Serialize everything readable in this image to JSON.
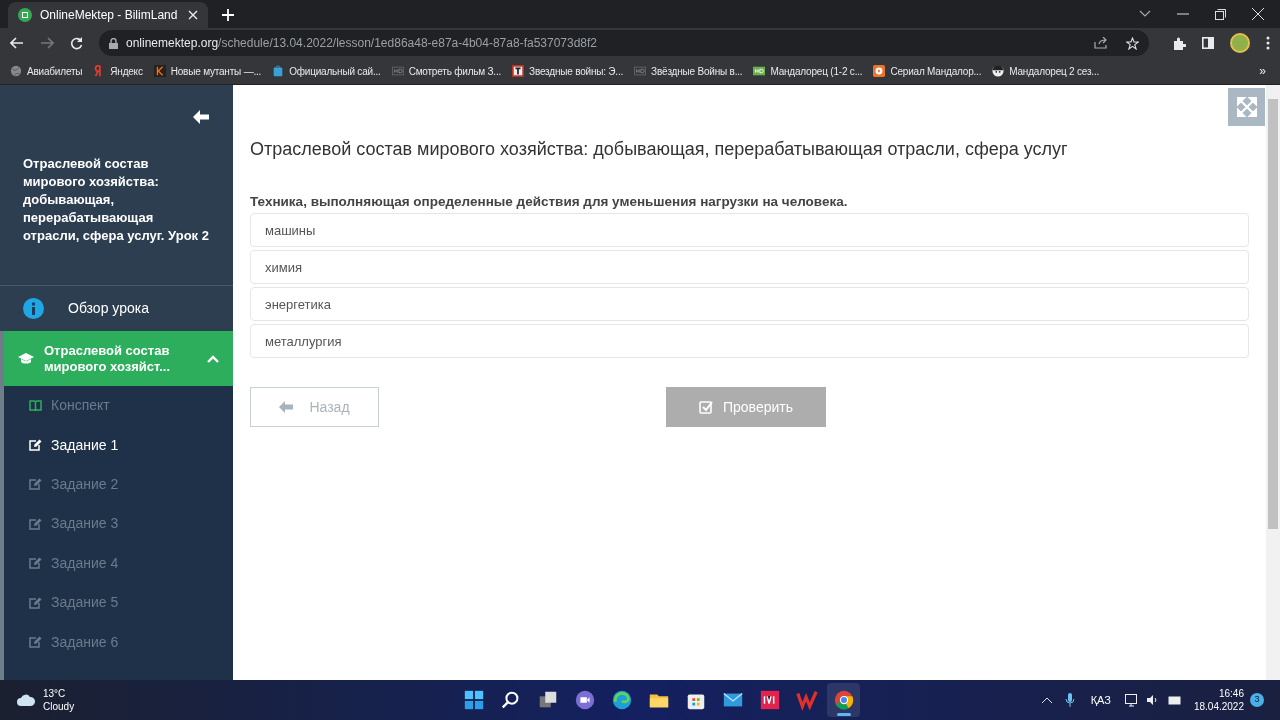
{
  "browser": {
    "tab": {
      "title": "OnlineMektep - BilimLand"
    },
    "url_host": "onlinemektep.org",
    "url_path": "/schedule/13.04.2022/lesson/1ed86a48-e87a-4b04-87a8-fa537073d8f2",
    "bookmarks": [
      {
        "label": "Авиабилеты",
        "kind": "globe"
      },
      {
        "label": "Яндекс",
        "kind": "yandex"
      },
      {
        "label": "Новые мутанты —...",
        "kind": "k"
      },
      {
        "label": "Официальный сай...",
        "kind": "bag"
      },
      {
        "label": "Смотреть фильм З...",
        "kind": "hd"
      },
      {
        "label": "Звездные войны: Э...",
        "kind": "t"
      },
      {
        "label": "Звёздные Войны в...",
        "kind": "hd"
      },
      {
        "label": "Мандалорец (1-2 с...",
        "kind": "hdgreen"
      },
      {
        "label": "Сериал Мандалор...",
        "kind": "play"
      },
      {
        "label": "Мандалорец 2 сез...",
        "kind": "face"
      }
    ],
    "bookmarks_more": "»"
  },
  "sidebar": {
    "title": "Отраслевой состав мирового хозяйства: добывающая, перерабатывающая отрасли, сфера услуг. Урок 2",
    "overview": "Обзор урока",
    "section": {
      "label": "Отраслевой состав мирового хозяйст...",
      "expanded": true,
      "items": [
        {
          "label": "Конспект",
          "kind": "notes",
          "selected": false
        },
        {
          "label": "Задание 1",
          "kind": "task",
          "selected": true
        },
        {
          "label": "Задание 2",
          "kind": "task",
          "selected": false
        },
        {
          "label": "Задание 3",
          "kind": "task",
          "selected": false
        },
        {
          "label": "Задание 4",
          "kind": "task",
          "selected": false
        },
        {
          "label": "Задание 5",
          "kind": "task",
          "selected": false
        },
        {
          "label": "Задание 6",
          "kind": "task",
          "selected": false
        }
      ]
    }
  },
  "main": {
    "title": "Отраслевой состав мирового хозяйства: добывающая, перерабатывающая отрасли, сфера услуг",
    "question": "Техника, выполняющая определенные действия для уменьшения нагрузки на человека.",
    "options": [
      {
        "label": "машины",
        "selected": false
      },
      {
        "label": "химия",
        "selected": false
      },
      {
        "label": "энергетика",
        "selected": false
      },
      {
        "label": "металлургия",
        "selected": false
      }
    ],
    "back_button": {
      "label": "Назад",
      "disabled": true
    },
    "check_button": {
      "label": "Проверить",
      "disabled": true
    }
  },
  "taskbar": {
    "weather": {
      "temp": "13°C",
      "condition": "Cloudy"
    },
    "apps": [
      {
        "kind": "start",
        "active": false
      },
      {
        "kind": "search",
        "active": false
      },
      {
        "kind": "taskview",
        "active": false
      },
      {
        "kind": "chat",
        "active": false
      },
      {
        "kind": "edge",
        "active": false
      },
      {
        "kind": "files",
        "active": false
      },
      {
        "kind": "store",
        "active": false
      },
      {
        "kind": "mail",
        "active": false
      },
      {
        "kind": "ivi",
        "active": false
      },
      {
        "kind": "wps",
        "active": false
      },
      {
        "kind": "chrome",
        "active": true
      }
    ],
    "language": "ҚАЗ",
    "time": "16:46",
    "date": "18.04.2022",
    "notifications": "3"
  }
}
